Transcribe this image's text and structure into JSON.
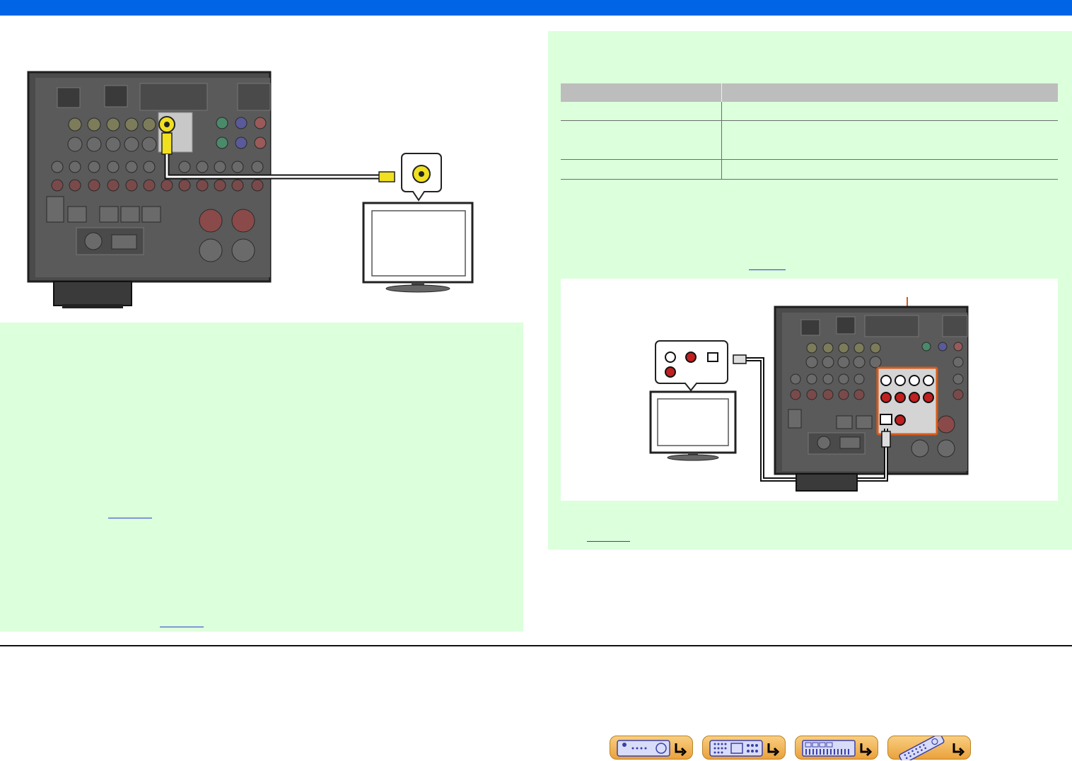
{
  "colors": {
    "header_bar": "#0064e6",
    "panel_background": "#dcffdc",
    "link": "#2b3fd6",
    "highlight_orange": "#d85a1a",
    "video_cable_yellow": "#f0e020",
    "nav_button": "#f0b45a"
  },
  "spec_table": {
    "rows": 3,
    "columns": 2
  },
  "footer_nav": [
    {
      "icon": "receiver-front-icon"
    },
    {
      "icon": "receiver-rear-icon"
    },
    {
      "icon": "menu-panel-icon"
    },
    {
      "icon": "remote-control-icon"
    }
  ]
}
